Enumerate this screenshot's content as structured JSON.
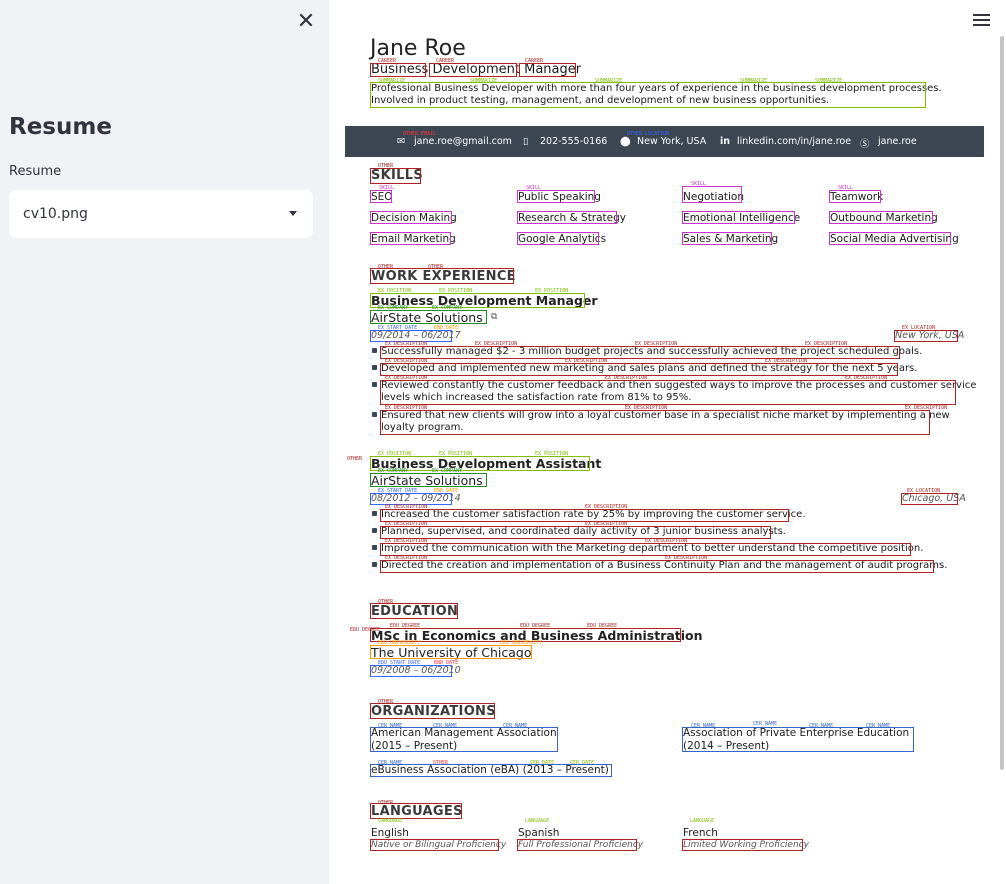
{
  "sidebar": {
    "title": "Resume",
    "select_label": "Resume",
    "select_value": "cv10.png",
    "close_glyph": "✕"
  },
  "main": {
    "menu_icon": "hamburger-menu-icon"
  },
  "colors": {
    "sidebar_bg": "#f0f2f6",
    "contact_bar": "#3d4653",
    "ann_career": "#b22222",
    "ann_summary": "#7cc000",
    "ann_skill": "#cc33cc",
    "ann_exp": "#b22222",
    "ann_edu": "#b22222",
    "ann_cert": "#3366cc"
  },
  "resume": {
    "name": "Jane Roe",
    "role": "Business Development Manager",
    "summary_line1": "Professional Business Developer with more than four years of experience in the business development processes.",
    "summary_line2": "Involved in product testing, management, and development of new business opportunities.",
    "contact": {
      "email": "jane.roe@gmail.com",
      "phone": "202-555-0166",
      "location": "New York, USA",
      "linkedin": "linkedin.com/in/jane.roe",
      "skype": "jane.roe"
    },
    "skills_title": "SKILLS",
    "skills": [
      "SEO",
      "Public Speaking",
      "Negotiation",
      "Teamwork",
      "Decision Making",
      "Research & Strategy",
      "Emotional Intelligence",
      "Outbound Marketing",
      "Email Marketing",
      "Google Analytics",
      "Sales & Marketing",
      "Social Media Advertising"
    ],
    "work_title": "WORK EXPERIENCE",
    "jobs": [
      {
        "title": "Business Development Manager",
        "company": "AirState Solutions",
        "dates": "09/2014 – 06/2017",
        "location": "New York, USA",
        "bullets": [
          "Successfully managed $2 - 3 million budget projects and successfully achieved the project scheduled goals.",
          "Developed and implemented new marketing and sales plans and defined the strategy for the next 5 years.",
          "Reviewed constantly the customer feedback and then suggested ways to improve the processes and customer service",
          "levels which increased the satisfaction rate from 81% to 95%.",
          "Ensured that new clients will grow into a loyal customer base in a specialist niche market by implementing a new",
          "loyalty program."
        ]
      },
      {
        "title": "Business Development Assistant",
        "company": "AirState Solutions",
        "dates": "08/2012 – 09/2014",
        "location": "Chicago, USA",
        "bullets": [
          "Increased the customer satisfaction rate by 25% by improving the customer service.",
          "Planned, supervised, and coordinated daily activity of 3 junior business analysts.",
          "Improved the communication with the Marketing department to better understand the competitive position.",
          "Directed the creation and implementation of a Business Continuity Plan and the management of audit programs."
        ]
      }
    ],
    "education_title": "EDUCATION",
    "degree": "MSc in Economics and Business Administration",
    "university": "The University of Chicago",
    "edu_dates": "09/2008 – 06/2010",
    "orgs_title": "ORGANIZATIONS",
    "orgs": [
      "American Management Association",
      "(2015 – Present)",
      "Association of Private Enterprise Education",
      "(2014 – Present)",
      "eBusiness Association (eBA) (2013 – Present)"
    ],
    "languages_title": "LANGUAGES",
    "languages": [
      {
        "name": "English",
        "level": "Native or Bilingual Proficiency"
      },
      {
        "name": "Spanish",
        "level": "Full Professional Proficiency"
      },
      {
        "name": "French",
        "level": "Limited Working Proficiency"
      }
    ],
    "annotations": {
      "career": "CAREER",
      "summarize": "SUMMARIZE",
      "other": "OTHER",
      "skill": "SKILL",
      "ex_position": "EX POSITION",
      "ex_company": "EX COMPANY",
      "ex_start": "EX START DATE",
      "ex_end": "END DATE",
      "ex_location": "EX LOCATION",
      "ex_desc": "EX DESCRIPTION",
      "edu_degree": "EDU DEGREE",
      "edu_univ": "EDU UNIVERSITY",
      "edu_start": "EDU START DATE",
      "edu_end": "END DATE",
      "cer_name": "CER NAME",
      "cer_date": "CER DATE",
      "language": "LANGUAGE",
      "other_email": "OTHER EMAIL",
      "other_location": "OTHER LOCATION"
    }
  }
}
